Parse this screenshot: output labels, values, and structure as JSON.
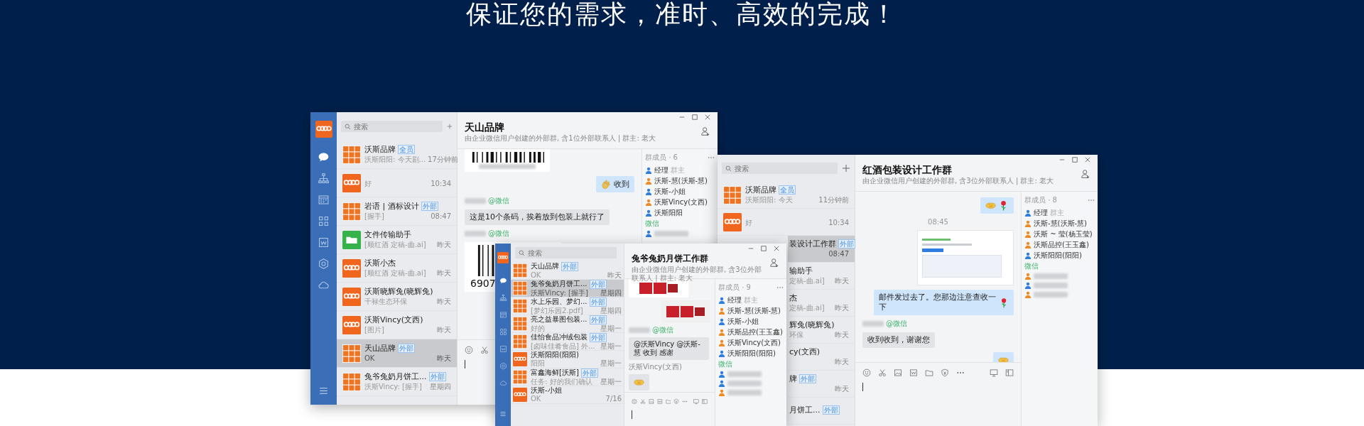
{
  "headline": "保证您的需求，准时、高效的完成！",
  "windows": [
    {
      "title": "天山品牌",
      "subtitle": "由企业微信用户创建的外部群, 含1位外部联系人 | 群主: 老大",
      "sidebar": {
        "items": [
          {
            "selected": true
          },
          {
            "selected": false
          },
          {
            "selected": false
          },
          {
            "selected": false
          },
          {
            "selected": false
          },
          {
            "selected": false
          },
          {
            "selected": false
          }
        ]
      },
      "search": {
        "placeholder": "搜索"
      },
      "conversations": [
        {
          "kind": "grid",
          "name": "沃斯品牌",
          "tag": "全员",
          "preview": "沃斯阳阳: 今天剧...",
          "time": "17分钟前",
          "selected": false
        },
        {
          "kind": "logo",
          "preview": "好",
          "time": "10:34",
          "selected": false
        },
        {
          "kind": "grid",
          "name": "岩语 | 酒标设计",
          "tag": "外部",
          "preview": "[握手]",
          "time": "08:47",
          "selected": false
        },
        {
          "kind": "folder",
          "name": "文件传输助手",
          "preview": "[顺红酒 定稿-曲.ai]",
          "time": "昨天",
          "selected": false
        },
        {
          "kind": "logo",
          "name": "沃斯小杰",
          "preview": "[顺红酒 定稿-曲.ai]",
          "time": "昨天",
          "selected": false
        },
        {
          "kind": "logo",
          "name": "沃斯晓辉兔(晓辉兔)",
          "preview": "千禄生态环保",
          "time": "昨天",
          "selected": false
        },
        {
          "kind": "logo",
          "name": "沃斯Vincy(文西)",
          "preview": "[图片]",
          "time": "昨天",
          "selected": false
        },
        {
          "kind": "grid",
          "name": "天山品牌",
          "tag": "外部",
          "preview": "OK",
          "time": "昨天",
          "selected": true
        },
        {
          "kind": "grid",
          "name": "兔爷兔奶月饼工...",
          "tag": "外部",
          "preview": "沃斯Vincy: [握手]",
          "time": "星期四",
          "selected": false
        }
      ],
      "messages": [
        {
          "kind": "barcode",
          "cut": true
        },
        {
          "kind": "sent-bubble",
          "emoji": [
            {
              "kind": "ok-hand"
            }
          ],
          "text": "收到"
        },
        {
          "kind": "sender",
          "source": "@微信"
        },
        {
          "kind": "received-bubble",
          "text": "这是10个条码，挨着放到包装上就行了"
        },
        {
          "kind": "sender",
          "source": "@微信"
        },
        {
          "kind": "barcode",
          "cut": false,
          "digits": "6907"
        }
      ],
      "members": {
        "title": "群成员 · 6",
        "items": [
          {
            "kind": "member",
            "name": "经理",
            "role": "群主",
            "color": "#2f7de1"
          },
          {
            "kind": "member",
            "name": "沃斯-慧(沃斯-慧)",
            "color": "#f08a24"
          },
          {
            "kind": "member",
            "name": "沃斯-小姐",
            "color": "#2f7de1"
          },
          {
            "kind": "member",
            "name": "沃斯Vincy(文西)",
            "color": "#f08a24"
          },
          {
            "kind": "member",
            "name": "沃斯阳阳",
            "color": "#2f7de1"
          },
          {
            "kind": "section",
            "label": "微信"
          },
          {
            "kind": "blurred",
            "color": "#2f7de1"
          }
        ]
      }
    },
    {
      "title": "红酒包装设计工作群",
      "subtitle": "由企业微信用户创建的外部群, 含3位外部联系人 | 群主: 老大",
      "search": {
        "placeholder": "搜索"
      },
      "conversations": [
        {
          "kind": "grid",
          "name": "沃斯品牌",
          "tag": "全员",
          "preview": "沃斯阳阳: 今天",
          "time": "11分钟前",
          "selected": false
        },
        {
          "kind": "logo",
          "preview": "好",
          "time": "10:34",
          "selected": false
        },
        {
          "kind": "partial",
          "name": "装设计工作群",
          "tag": "外部",
          "time": "08:47",
          "selected": true
        },
        {
          "kind": "partial",
          "name": "输助手",
          "preview": "定稿-曲.ai]",
          "time": "昨天",
          "selected": false
        },
        {
          "kind": "partial",
          "name": "杰",
          "preview": "定稿-曲.ai]",
          "time": "昨天",
          "selected": false
        },
        {
          "kind": "partial",
          "name": "辉兔(晓辉兔)",
          "preview": "环保",
          "time": "昨天",
          "selected": false
        },
        {
          "kind": "partial",
          "name": "cy(文西)",
          "time": "昨天",
          "selected": false
        },
        {
          "kind": "partial",
          "name": "牌",
          "tag": "外部",
          "time": "昨天",
          "selected": false
        },
        {
          "kind": "partial",
          "name": "月饼工...",
          "tag": "外部",
          "selected": false
        }
      ],
      "messages": [
        {
          "kind": "sent-bubble",
          "emoji": [
            {
              "kind": "handshake"
            },
            {
              "kind": "rose"
            }
          ]
        },
        {
          "kind": "time",
          "text": "08:45"
        },
        {
          "kind": "sent-screenshot"
        },
        {
          "kind": "sent-bubble",
          "text": "邮件发过去了。您那边注意查收一下",
          "emoji_after": [
            {
              "kind": "rose"
            }
          ]
        },
        {
          "kind": "sender",
          "source": "@微信"
        },
        {
          "kind": "received-bubble",
          "text": "收到收到，谢谢您"
        },
        {
          "kind": "sent-bubble",
          "emoji": [
            {
              "kind": "handshake"
            }
          ]
        }
      ],
      "members": {
        "title": "群成员 · 8",
        "items": [
          {
            "kind": "member",
            "name": "经理",
            "role": "群主",
            "color": "#2f7de1"
          },
          {
            "kind": "member",
            "name": "沃斯-慧(沃斯-慧)",
            "color": "#f08a24"
          },
          {
            "kind": "member",
            "name": "沃斯 ~ 莹(杨玉莹)",
            "color": "#f08a24"
          },
          {
            "kind": "member",
            "name": "沃斯品控(王玉鑫)",
            "color": "#f08a24"
          },
          {
            "kind": "member",
            "name": "沃斯阳阳(阳阳)",
            "color": "#2f7de1"
          },
          {
            "kind": "section",
            "label": "微信"
          },
          {
            "kind": "blurred",
            "color": "#f08a24"
          },
          {
            "kind": "blurred",
            "color": "#2f7de1"
          },
          {
            "kind": "blurred",
            "color": "#f08a24"
          }
        ]
      }
    },
    {
      "title": "兔爷兔奶月饼工作群",
      "subtitle": "由企业微信用户创建的外部群, 含3位外部联系人 | 群主: 老大",
      "sidebar": {
        "items": [
          {
            "selected": true
          },
          {
            "selected": false
          },
          {
            "selected": false
          },
          {
            "selected": false
          },
          {
            "selected": false
          },
          {
            "selected": false
          },
          {
            "selected": false
          }
        ]
      },
      "search": {
        "placeholder": "搜索"
      },
      "conversations": [
        {
          "kind": "grid",
          "name": "天山品牌",
          "tag": "外部",
          "preview": "OK",
          "time": "昨天",
          "selected": false
        },
        {
          "kind": "grid",
          "name": "兔爷兔奶月饼工...",
          "tag": "外部",
          "preview": "沃斯Vincy: [握手]",
          "time": "星期四",
          "selected": true
        },
        {
          "kind": "grid",
          "name": "水上乐园、梦幻...",
          "tag": "外部",
          "preview": "[梦幻乐园2.pdf]",
          "time": "星期四",
          "selected": false
        },
        {
          "kind": "grid",
          "name": "亮之益暴图包装...",
          "tag": "外部",
          "preview": "好的",
          "time": "星期一",
          "selected": false
        },
        {
          "kind": "grid",
          "name": "佳怡食品冲绒包装",
          "tag": "外部",
          "preview": "[卤味佳肴食品] 外...",
          "time": "星期一",
          "selected": false
        },
        {
          "kind": "logo",
          "name": "沃斯阳阳(阳阳)",
          "preview": "阳阳",
          "time": "星期一",
          "selected": false
        },
        {
          "kind": "grid",
          "name": "富鑫海鲜[沃斯]",
          "tag": "外部",
          "preview": "任务: 好的我们确认",
          "time": "星期一",
          "selected": false
        },
        {
          "kind": "logo",
          "name": "沃斯-小姐",
          "preview": "OK",
          "time": "7/16",
          "selected": false
        }
      ],
      "messages": [
        {
          "kind": "received-product-image"
        },
        {
          "kind": "sent-product-image"
        },
        {
          "kind": "sender",
          "source": "@微信"
        },
        {
          "kind": "received-bubble",
          "text": "@沃斯Vincy @沃斯-慧  收到  感谢"
        },
        {
          "kind": "sender",
          "name": "沃斯Vincy(文西)"
        },
        {
          "kind": "received-bubble",
          "emoji": [
            {
              "kind": "handshake"
            }
          ]
        }
      ],
      "members": {
        "title": "群成员 · 9",
        "items": [
          {
            "kind": "member",
            "name": "经理",
            "role": "群主",
            "color": "#2f7de1"
          },
          {
            "kind": "member",
            "name": "沃斯-慧(沃斯-慧)",
            "color": "#f08a24"
          },
          {
            "kind": "member",
            "name": "沃斯-小姐",
            "color": "#2f7de1"
          },
          {
            "kind": "member",
            "name": "沃斯品控(王玉鑫)",
            "color": "#f08a24"
          },
          {
            "kind": "member",
            "name": "沃斯Vincy(文西)",
            "color": "#f08a24"
          },
          {
            "kind": "member",
            "name": "沃斯阳阳(阳阳)",
            "color": "#2f7de1"
          },
          {
            "kind": "section",
            "label": "微信"
          },
          {
            "kind": "blurred",
            "color": "#2f7de1"
          },
          {
            "kind": "blurred",
            "color": "#2f7de1"
          },
          {
            "kind": "blurred",
            "color": "#f08a24"
          }
        ]
      }
    }
  ]
}
